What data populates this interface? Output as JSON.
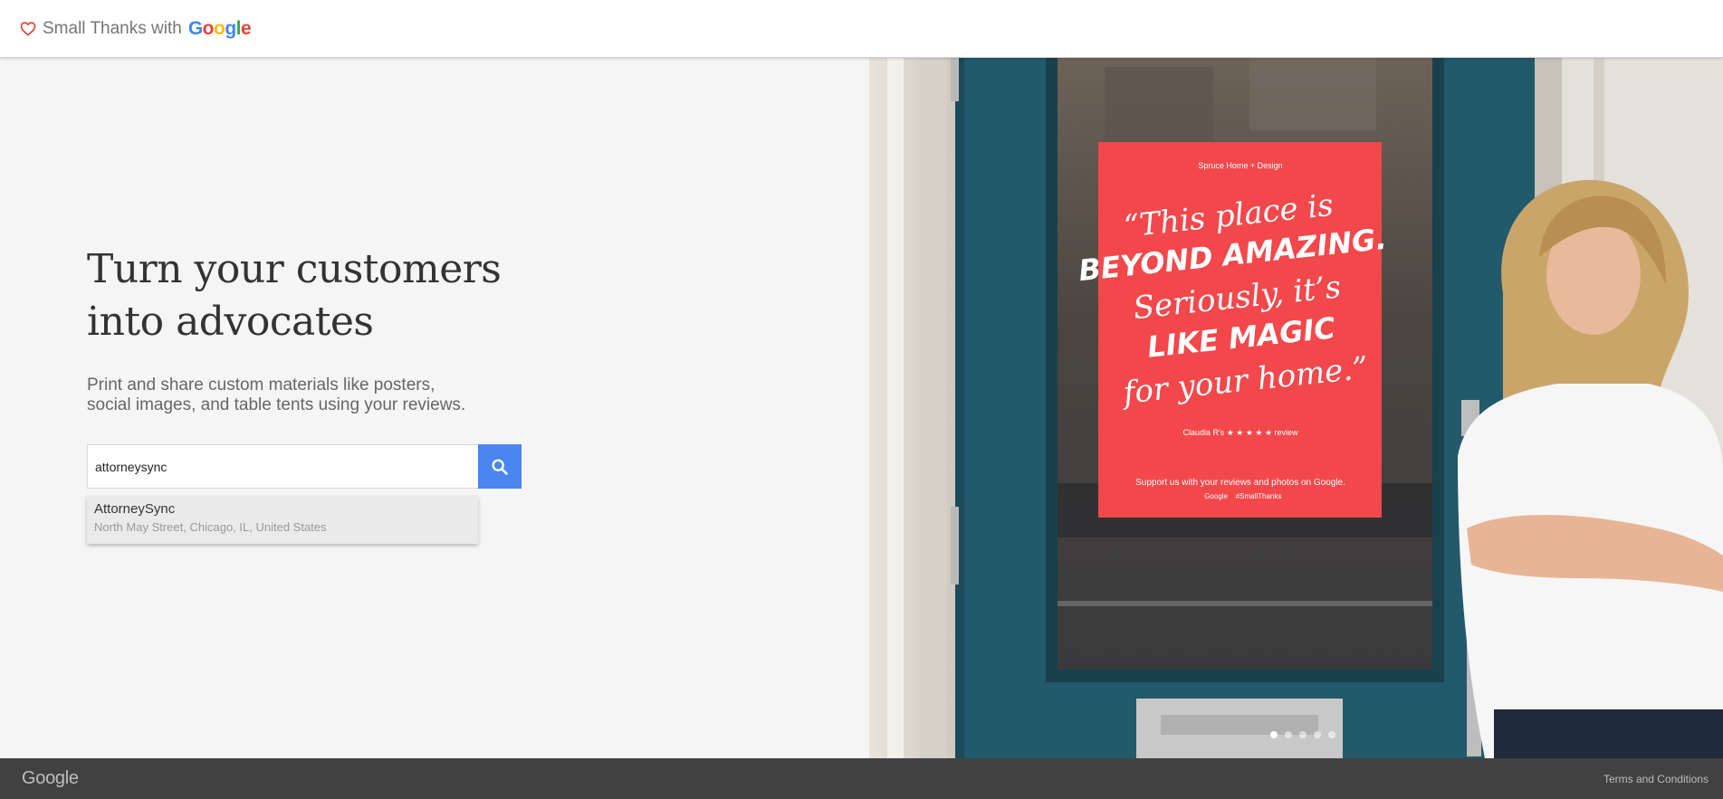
{
  "header": {
    "brand_prefix": "Small Thanks with",
    "brand_google": [
      "G",
      "o",
      "o",
      "g",
      "l",
      "e"
    ],
    "brand_colors": [
      "#4285F4",
      "#EA4335",
      "#FBBC05",
      "#4285F4",
      "#34A853",
      "#EA4335"
    ]
  },
  "hero": {
    "headline_line1": "Turn your customers",
    "headline_line2": "into advocates",
    "subhead_line1": "Print and share custom materials like posters,",
    "subhead_line2": "social images, and table tents using your reviews."
  },
  "search": {
    "value": "attorneysync",
    "button_icon": "search-icon"
  },
  "suggestion": {
    "name": "AttorneySync",
    "address": "North May Street, Chicago, IL, United States"
  },
  "poster": {
    "location": "Spruce Home + Design",
    "quote_line1": "“This place is",
    "quote_line2": "BEYOND AMAZING.",
    "quote_line3": "Seriously, it’s",
    "quote_line4": "LIKE MAGIC",
    "quote_line5": "for your home.”",
    "reviewer": "Claudia R's ★ ★ ★ ★ ★ review",
    "support": "Support us with your reviews and photos on Google.",
    "tag_google": "Google",
    "tag_hashtag": "#SmallThanks",
    "bg_color": "#f2484b"
  },
  "carousel": {
    "dots": 5,
    "active_index": 0
  },
  "footer": {
    "logo": "Google",
    "terms": "Terms and Conditions"
  },
  "colors": {
    "accent": "#4a86f0",
    "door": "#22596b",
    "footer_bg": "#414141"
  }
}
